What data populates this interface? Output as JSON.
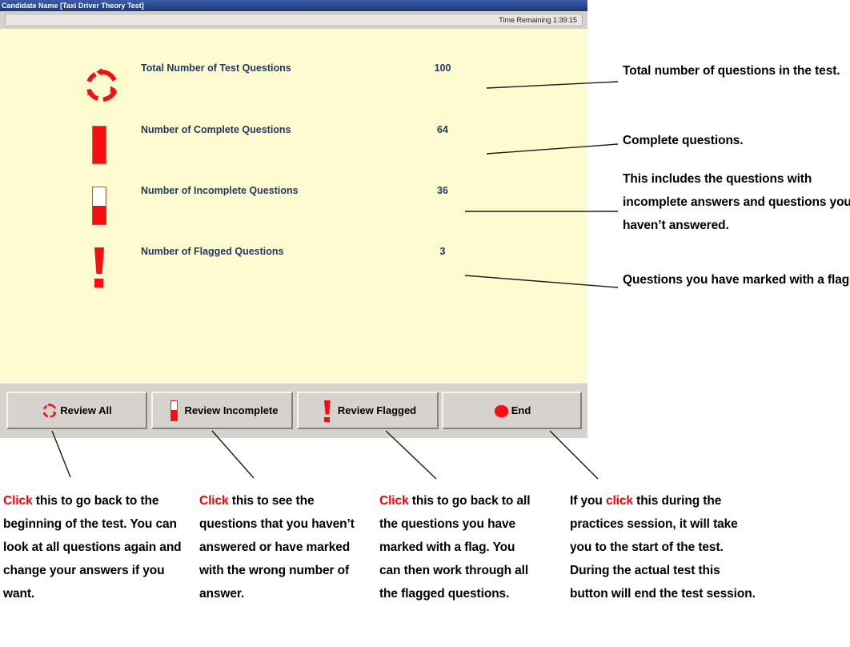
{
  "window": {
    "title": "Candidate Name [Taxi Driver Theory Test]",
    "time_remaining": "Time Remaining 1:39:15",
    "background_color": "#fdfbcf",
    "titlebar_color": "#2d4b8e",
    "accent_color": "#f41010",
    "label_color": "#223a63"
  },
  "summary": {
    "rows": [
      {
        "icon": "cycle-icon",
        "label": "Total Number of Test Questions",
        "value": "100"
      },
      {
        "icon": "bar-full-icon",
        "label": "Number of Complete Questions",
        "value": "64"
      },
      {
        "icon": "bar-half-icon",
        "label": "Number of Incomplete Questions",
        "value": "36"
      },
      {
        "icon": "exclamation-icon",
        "label": "Number of Flagged Questions",
        "value": "3"
      }
    ]
  },
  "toolbar": {
    "buttons": [
      {
        "icon": "cycle-icon",
        "label": "Review All"
      },
      {
        "icon": "bar-half-icon",
        "label": "Review Incomplete"
      },
      {
        "icon": "exclamation-icon",
        "label": "Review Flagged"
      },
      {
        "icon": "stop-blob-icon",
        "label": "End"
      }
    ]
  },
  "annotations": {
    "right": [
      {
        "text": "Total number of questions in the test."
      },
      {
        "text": "Complete questions."
      },
      {
        "text": "This includes the questions with incomplete answers and questions you haven’t answered."
      },
      {
        "text": "Questions you have marked with a flag."
      }
    ],
    "bottom": [
      {
        "highlight": "Click",
        "text": " this to go back to the beginning of the test. You can look at all questions again and change your answers if you want."
      },
      {
        "highlight": "Click",
        "text": " this to see the questions that you haven’t answered or have marked with the wrong number of answer."
      },
      {
        "highlight": "Click",
        "text": " this to go back to all the questions you have marked with a flag. You can then work through all the flagged questions."
      },
      {
        "prefix": "If you ",
        "highlight": "click",
        "text": " this during the practices session, it will take you to the start of the test. During the actual test this button will end the test session."
      }
    ]
  }
}
